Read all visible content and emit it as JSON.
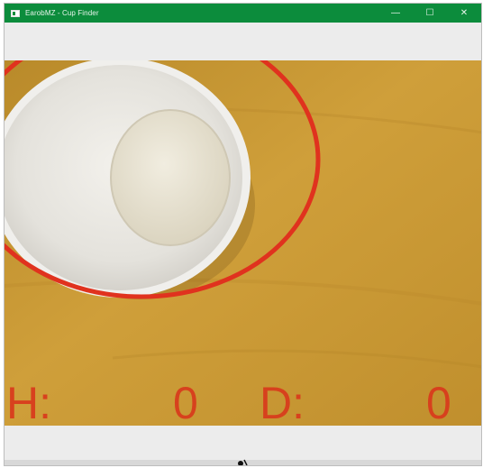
{
  "window": {
    "title": "EarobMZ - Cup Finder",
    "controls": {
      "minimize": "—",
      "maximize": "☐",
      "close": "✕"
    }
  },
  "readout": {
    "height_label": "H:",
    "height_value": "0",
    "diameter_label": "D:",
    "diameter_value": "0"
  },
  "colors": {
    "titlebar": "#0c8c3c",
    "detection_ellipse": "#e0321e",
    "overlay_text": "#d93a1c",
    "table_wood": "#c7962f"
  },
  "icons": {
    "app": "app-window-icon",
    "cursor": "mouse-cursor-icon"
  }
}
